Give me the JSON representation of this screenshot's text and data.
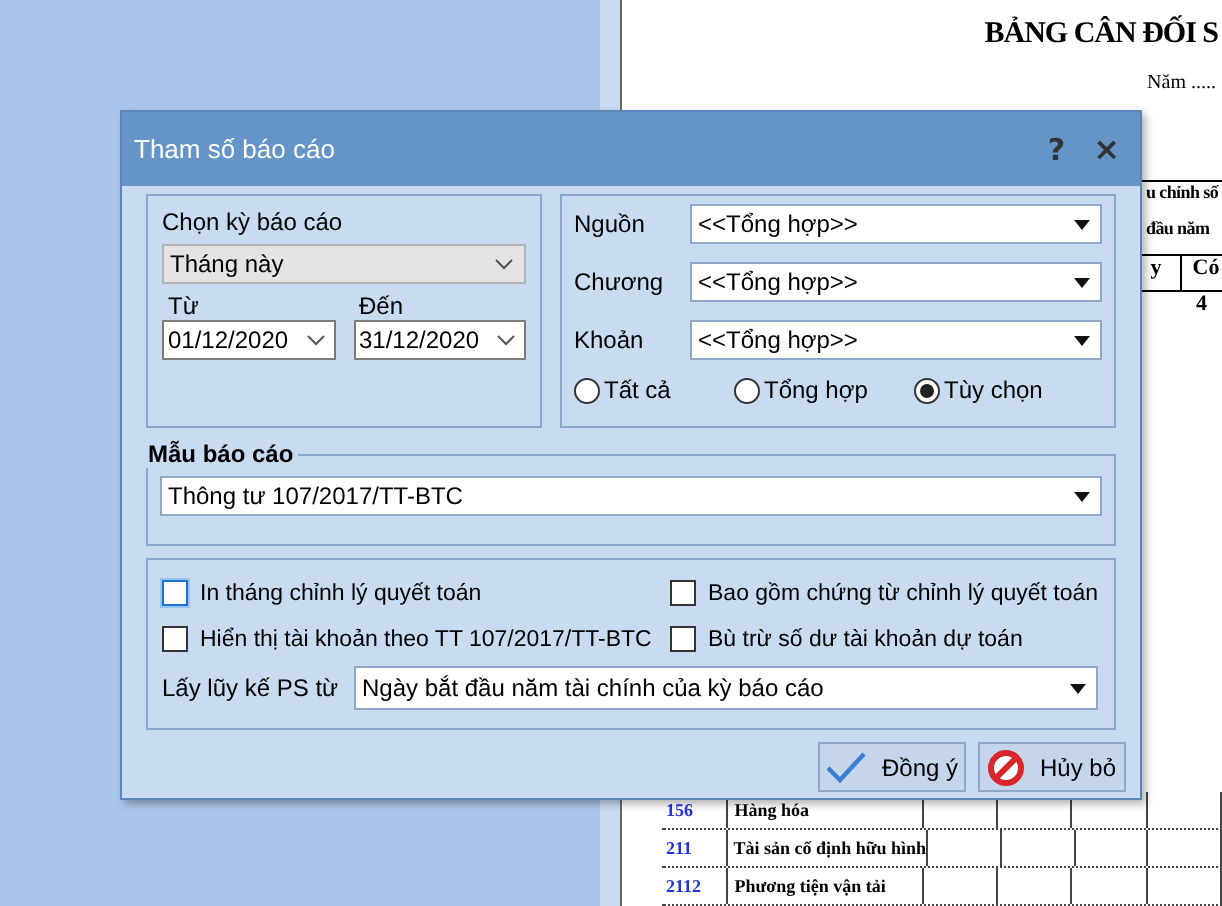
{
  "document": {
    "title": "BẢNG CÂN ĐỐI S",
    "year_label": "Năm .....",
    "header_lines": [
      "u chỉnh số",
      "đầu năm"
    ],
    "header_cells": [
      "y",
      "Có"
    ],
    "column_number": "4",
    "rows": [
      {
        "code": "156",
        "name": "Hàng hóa"
      },
      {
        "code": "211",
        "name": "Tài sản cố định hữu hình"
      },
      {
        "code": "2112",
        "name": "Phương tiện vận tải"
      }
    ]
  },
  "dialog": {
    "title": "Tham số báo cáo",
    "help": "?",
    "close": "×",
    "period": {
      "label": "Chọn kỳ báo cáo",
      "value": "Tháng này",
      "from_label": "Từ",
      "from": "01/12/2020",
      "to_label": "Đến",
      "to": "31/12/2020"
    },
    "filters": [
      {
        "label": "Nguồn",
        "value": "<<Tổng hợp>>"
      },
      {
        "label": "Chương",
        "value": "<<Tổng hợp>>"
      },
      {
        "label": "Khoản",
        "value": "<<Tổng hợp>>"
      }
    ],
    "scope_options": [
      {
        "label": "Tất cả",
        "selected": false
      },
      {
        "label": "Tổng hợp",
        "selected": false
      },
      {
        "label": "Tùy chọn",
        "selected": true
      }
    ],
    "template": {
      "legend": "Mẫu báo cáo",
      "value": "Thông tư 107/2017/TT-BTC"
    },
    "options": [
      {
        "label": "In tháng chỉnh lý quyết toán",
        "checked": false,
        "focused": true
      },
      {
        "label": "Bao gồm chứng từ chỉnh lý quyết toán",
        "checked": false,
        "focused": false
      },
      {
        "label": "Hiển thị tài khoản theo TT 107/2017/TT-BTC",
        "checked": false,
        "focused": false
      },
      {
        "label": "Bù trừ số dư tài khoản dự toán",
        "checked": false,
        "focused": false
      }
    ],
    "accumulate": {
      "label": "Lấy lũy kế PS từ",
      "value": "Ngày bắt đầu năm tài chính của kỳ báo cáo"
    },
    "buttons": [
      {
        "label": "Đồng ý",
        "kind": "ok"
      },
      {
        "label": "Hủy bỏ",
        "kind": "cancel"
      }
    ]
  }
}
